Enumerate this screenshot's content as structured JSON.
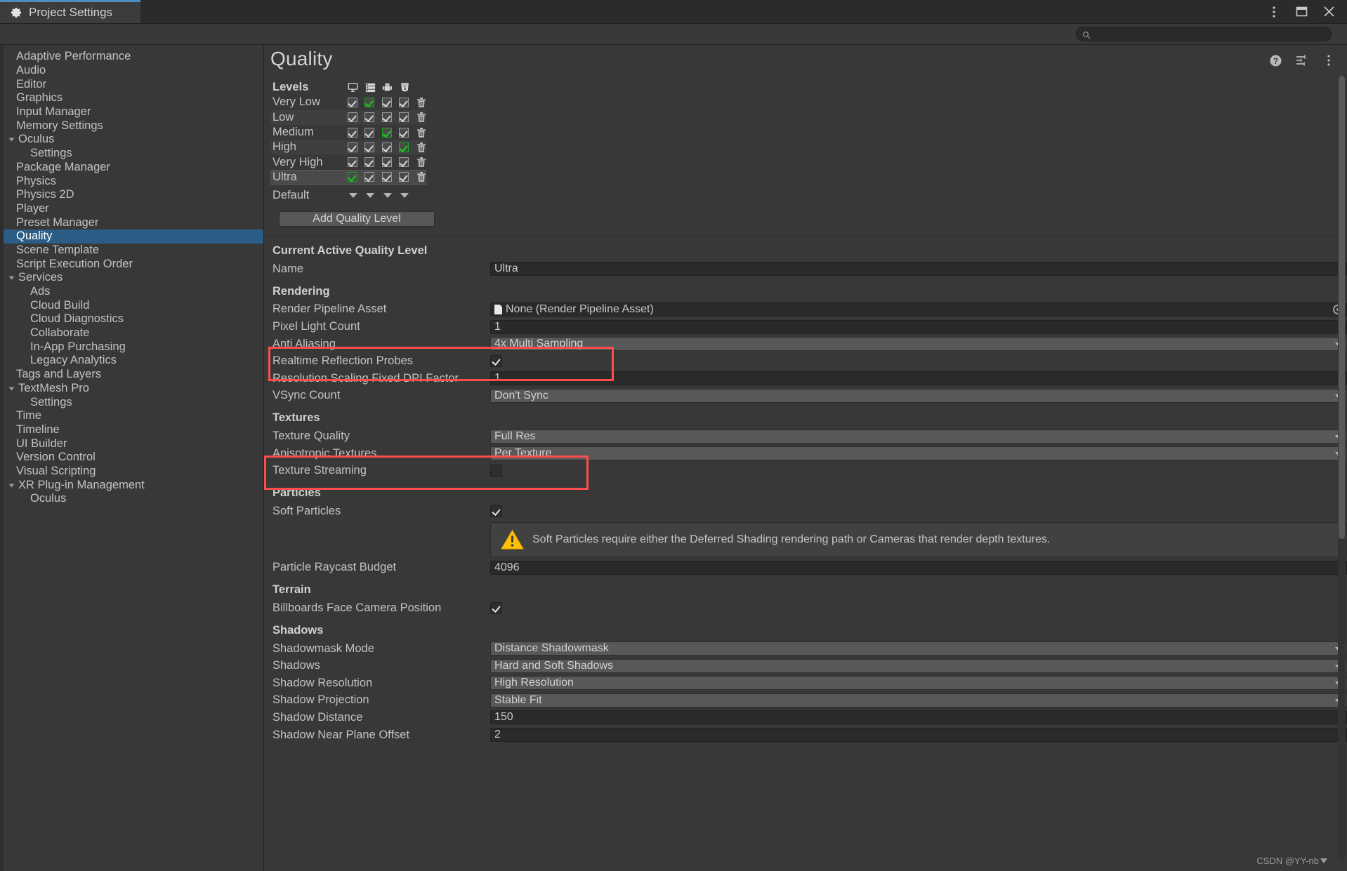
{
  "window": {
    "tab_title": "Project Settings",
    "gear_icon": "gear-icon",
    "menu_icon": "kebab-menu-icon",
    "maximize_icon": "maximize-icon",
    "close_icon": "close-icon"
  },
  "search": {
    "value": "",
    "placeholder": "",
    "icon": "search-icon"
  },
  "sidebar": {
    "items": [
      {
        "label": "Adaptive Performance",
        "depth": 0,
        "arrow": false,
        "selected": false
      },
      {
        "label": "Audio",
        "depth": 0,
        "arrow": false,
        "selected": false
      },
      {
        "label": "Editor",
        "depth": 0,
        "arrow": false,
        "selected": false
      },
      {
        "label": "Graphics",
        "depth": 0,
        "arrow": false,
        "selected": false
      },
      {
        "label": "Input Manager",
        "depth": 0,
        "arrow": false,
        "selected": false
      },
      {
        "label": "Memory Settings",
        "depth": 0,
        "arrow": false,
        "selected": false
      },
      {
        "label": "Oculus",
        "depth": 0,
        "arrow": true,
        "selected": false
      },
      {
        "label": "Settings",
        "depth": 1,
        "arrow": false,
        "selected": false
      },
      {
        "label": "Package Manager",
        "depth": 0,
        "arrow": false,
        "selected": false
      },
      {
        "label": "Physics",
        "depth": 0,
        "arrow": false,
        "selected": false
      },
      {
        "label": "Physics 2D",
        "depth": 0,
        "arrow": false,
        "selected": false
      },
      {
        "label": "Player",
        "depth": 0,
        "arrow": false,
        "selected": false
      },
      {
        "label": "Preset Manager",
        "depth": 0,
        "arrow": false,
        "selected": false
      },
      {
        "label": "Quality",
        "depth": 0,
        "arrow": false,
        "selected": true
      },
      {
        "label": "Scene Template",
        "depth": 0,
        "arrow": false,
        "selected": false
      },
      {
        "label": "Script Execution Order",
        "depth": 0,
        "arrow": false,
        "selected": false
      },
      {
        "label": "Services",
        "depth": 0,
        "arrow": true,
        "selected": false
      },
      {
        "label": "Ads",
        "depth": 1,
        "arrow": false,
        "selected": false
      },
      {
        "label": "Cloud Build",
        "depth": 1,
        "arrow": false,
        "selected": false
      },
      {
        "label": "Cloud Diagnostics",
        "depth": 1,
        "arrow": false,
        "selected": false
      },
      {
        "label": "Collaborate",
        "depth": 1,
        "arrow": false,
        "selected": false
      },
      {
        "label": "In-App Purchasing",
        "depth": 1,
        "arrow": false,
        "selected": false
      },
      {
        "label": "Legacy Analytics",
        "depth": 1,
        "arrow": false,
        "selected": false
      },
      {
        "label": "Tags and Layers",
        "depth": 0,
        "arrow": false,
        "selected": false
      },
      {
        "label": "TextMesh Pro",
        "depth": 0,
        "arrow": true,
        "selected": false
      },
      {
        "label": "Settings",
        "depth": 1,
        "arrow": false,
        "selected": false
      },
      {
        "label": "Time",
        "depth": 0,
        "arrow": false,
        "selected": false
      },
      {
        "label": "Timeline",
        "depth": 0,
        "arrow": false,
        "selected": false
      },
      {
        "label": "UI Builder",
        "depth": 0,
        "arrow": false,
        "selected": false
      },
      {
        "label": "Version Control",
        "depth": 0,
        "arrow": false,
        "selected": false
      },
      {
        "label": "Visual Scripting",
        "depth": 0,
        "arrow": false,
        "selected": false
      },
      {
        "label": "XR Plug-in Management",
        "depth": 0,
        "arrow": true,
        "selected": false
      },
      {
        "label": "Oculus",
        "depth": 1,
        "arrow": false,
        "selected": false
      }
    ]
  },
  "page": {
    "title": "Quality",
    "help_icon": "help-icon",
    "presets_icon": "preset-sliders-icon",
    "more_icon": "kebab-menu-icon"
  },
  "levels": {
    "header_label": "Levels",
    "platform_icons": [
      "standalone-monitor-icon",
      "server-icon",
      "android-icon",
      "webgl-html5-icon"
    ],
    "rows": [
      {
        "name": "Very Low",
        "checks": [
          true,
          true,
          true,
          true
        ],
        "green": [
          false,
          true,
          false,
          false
        ],
        "selected": false
      },
      {
        "name": "Low",
        "checks": [
          true,
          true,
          true,
          true
        ],
        "green": [
          false,
          false,
          false,
          false
        ],
        "selected": false
      },
      {
        "name": "Medium",
        "checks": [
          true,
          true,
          true,
          true
        ],
        "green": [
          false,
          false,
          true,
          false
        ],
        "selected": false
      },
      {
        "name": "High",
        "checks": [
          true,
          true,
          true,
          true
        ],
        "green": [
          false,
          false,
          false,
          true
        ],
        "selected": false
      },
      {
        "name": "Very High",
        "checks": [
          true,
          true,
          true,
          true
        ],
        "green": [
          false,
          false,
          false,
          false
        ],
        "selected": false
      },
      {
        "name": "Ultra",
        "checks": [
          true,
          true,
          true,
          true
        ],
        "green": [
          true,
          false,
          false,
          false
        ],
        "selected": true
      }
    ],
    "delete_icon": "trash-icon",
    "default_label": "Default",
    "default_dropdowns": 4,
    "add_button_label": "Add Quality Level"
  },
  "sections": {
    "current_level": {
      "title": "Current Active Quality Level",
      "name_label": "Name",
      "name_value": "Ultra"
    },
    "rendering": {
      "title": "Rendering",
      "rows": [
        {
          "label": "Render Pipeline Asset",
          "type": "object",
          "value": "None (Render Pipeline Asset)"
        },
        {
          "label": "Pixel Light Count",
          "type": "number",
          "value": "1"
        },
        {
          "label": "Anti Aliasing",
          "type": "dropdown",
          "value": "4x Multi Sampling"
        },
        {
          "label": "Realtime Reflection Probes",
          "type": "toggle",
          "value": true
        },
        {
          "label": "Resolution Scaling Fixed DPI Factor",
          "type": "number",
          "value": "1"
        },
        {
          "label": "VSync Count",
          "type": "dropdown",
          "value": "Don't Sync"
        }
      ]
    },
    "textures": {
      "title": "Textures",
      "rows": [
        {
          "label": "Texture Quality",
          "type": "dropdown",
          "value": "Full Res"
        },
        {
          "label": "Anisotropic Textures",
          "type": "dropdown",
          "value": "Per Texture"
        },
        {
          "label": "Texture Streaming",
          "type": "toggle",
          "value": false
        }
      ]
    },
    "particles": {
      "title": "Particles",
      "rows": [
        {
          "label": "Soft Particles",
          "type": "toggle",
          "value": true
        }
      ],
      "warning": {
        "icon": "warning-triangle-icon",
        "text": "Soft Particles require either the Deferred Shading rendering path or Cameras that render depth textures."
      },
      "rows2": [
        {
          "label": "Particle Raycast Budget",
          "type": "number",
          "value": "4096"
        }
      ]
    },
    "terrain": {
      "title": "Terrain",
      "rows": [
        {
          "label": "Billboards Face Camera Position",
          "type": "toggle",
          "value": true
        }
      ]
    },
    "shadows": {
      "title": "Shadows",
      "rows": [
        {
          "label": "Shadowmask Mode",
          "type": "dropdown",
          "value": "Distance Shadowmask"
        },
        {
          "label": "Shadows",
          "type": "dropdown",
          "value": "Hard and Soft Shadows"
        },
        {
          "label": "Shadow Resolution",
          "type": "dropdown",
          "value": "High Resolution"
        },
        {
          "label": "Shadow Projection",
          "type": "dropdown",
          "value": "Stable Fit"
        },
        {
          "label": "Shadow Distance",
          "type": "number",
          "value": "150"
        },
        {
          "label": "Shadow Near Plane Offset",
          "type": "number",
          "value": "2"
        }
      ]
    }
  },
  "annotations": {
    "accent_color": "#ff4d4d",
    "boxes": [
      {
        "name": "highlight-pixel-light-anti-aliasing"
      },
      {
        "name": "highlight-texture-quality-anisotropic"
      }
    ]
  },
  "watermark": {
    "text": "CSDN @YY-nb"
  }
}
